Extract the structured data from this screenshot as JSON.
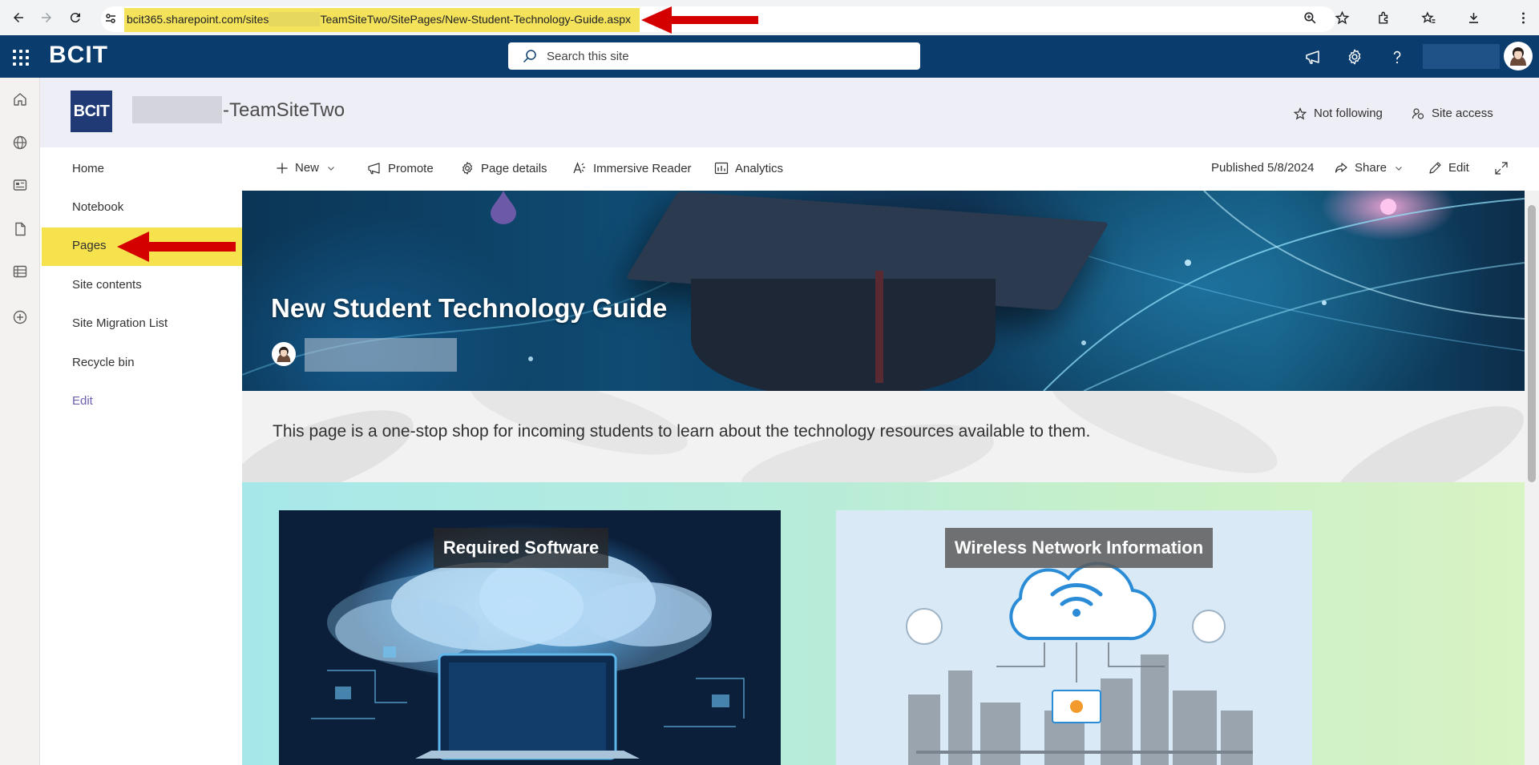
{
  "browser": {
    "url_prefix": "bcit365.sharepoint.com/sites",
    "url_suffix": "TeamSiteTwo/SitePages/New-Student-Technology-Guide.aspx"
  },
  "suite": {
    "brand": "BCIT",
    "search_placeholder": "Search this site"
  },
  "site": {
    "logo_text": "BCIT",
    "title": "-TeamSiteTwo",
    "follow_label": "Not following",
    "access_label": "Site access"
  },
  "nav": {
    "items": [
      "Home",
      "Notebook",
      "Pages",
      "Site contents",
      "Site Migration List",
      "Recycle bin"
    ],
    "edit_label": "Edit"
  },
  "commands": {
    "new": "New",
    "promote": "Promote",
    "page_details": "Page details",
    "immersive_reader": "Immersive Reader",
    "analytics": "Analytics",
    "published": "Published 5/8/2024",
    "share": "Share",
    "edit": "Edit"
  },
  "hero": {
    "title": "New Student Technology Guide"
  },
  "description": "This page is a one-stop shop for incoming students to learn about the technology resources available to them.",
  "cards": [
    {
      "label": "Required Software"
    },
    {
      "label": "Wireless Network Information"
    }
  ],
  "colors": {
    "suite_bar": "#0a3d6e",
    "highlight": "#f6e24d",
    "annotation_arrow": "#d40000"
  }
}
